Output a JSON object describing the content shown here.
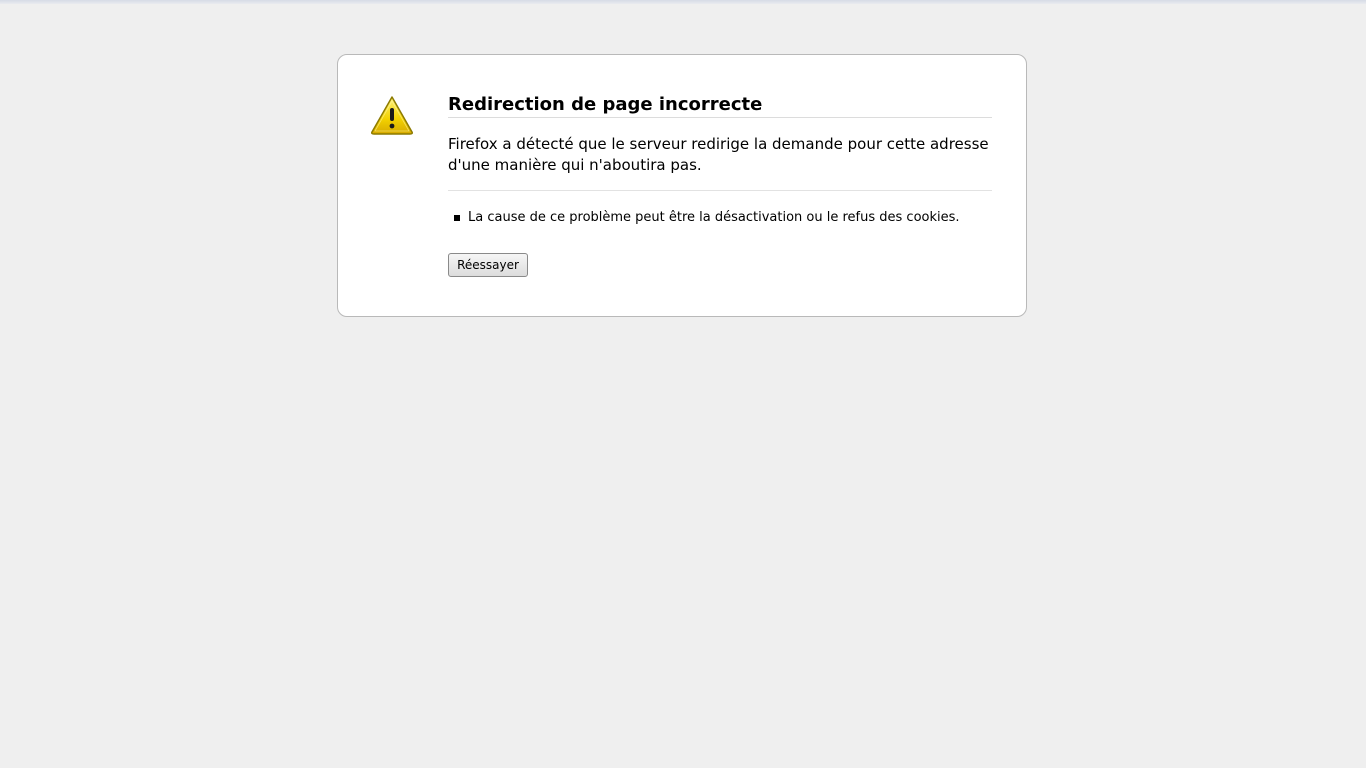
{
  "error": {
    "icon": "warning-icon",
    "title": "Redirection de page incorrecte",
    "description": "Firefox a détecté que le serveur redirige la demande pour cette adresse d'une manière qui n'aboutira pas.",
    "causes": [
      "La cause de ce problème peut être la désactivation ou le refus des cookies."
    ],
    "retry_label": "Réessayer"
  },
  "colors": {
    "background": "#efefef",
    "box": "#ffffff",
    "icon_yellow": "#f2d100",
    "icon_outline": "#7a6a00"
  }
}
